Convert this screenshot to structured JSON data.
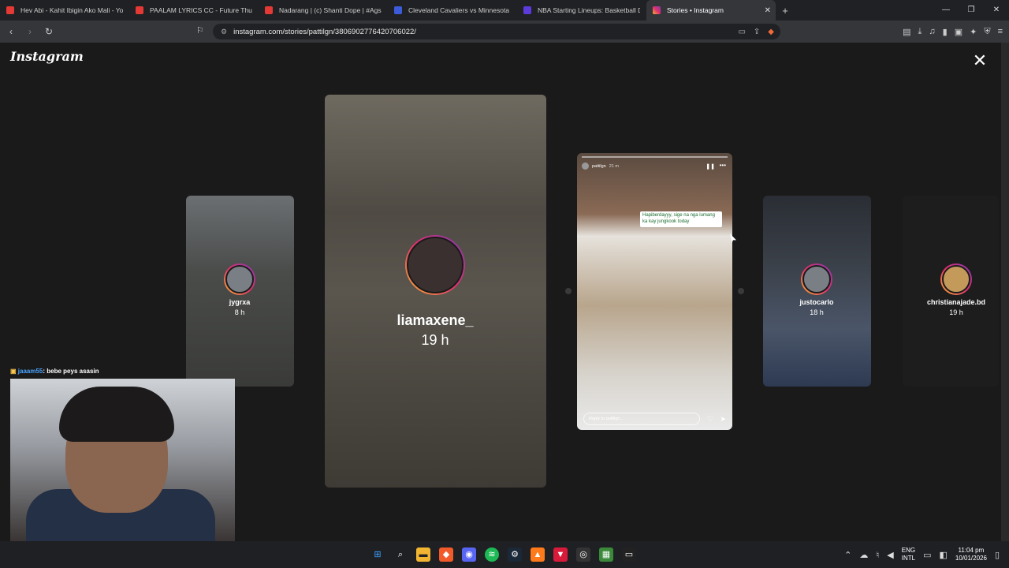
{
  "browser": {
    "tabs": [
      {
        "title": "Hev Abi - Kahit Ibigin Ako Mali - You",
        "color": "#e53935"
      },
      {
        "title": "PAALAM LYRICS CC - Future Thug ft.",
        "color": "#e53935"
      },
      {
        "title": "Nadarang | (c) Shanti Dope | #Agsun",
        "color": "#e53935"
      },
      {
        "title": "Cleveland Cavaliers vs Minnesota Tim",
        "color": "#3b5bdb"
      },
      {
        "title": "NBA Starting Lineups: Basketball Dai",
        "color": "#5c3bdb"
      },
      {
        "title": "Stories • Instagram",
        "color": "#e1306c",
        "active": true
      }
    ],
    "url": "instagram.com/stories/pattilgn/3806902776420706022/"
  },
  "instagram": {
    "logo": "Instagram",
    "close_icon": "close-icon",
    "previews": {
      "left": {
        "name": "jygrxa",
        "time": "8 h"
      },
      "center": {
        "name": "liamaxene_",
        "time": "19 h"
      },
      "right1": {
        "name": "justocarlo",
        "time": "18 h"
      },
      "right2": {
        "name": "christianajade.bd",
        "time": "19 h"
      }
    },
    "active_story": {
      "user": "pattilgn",
      "time": "21 m",
      "sticker_text": "Hapiberdayyy, sige na nga lumang ka kay jungkook today",
      "reply_placeholder": "Reply to pattilgn..."
    }
  },
  "stream": {
    "chat_user": "jaaam55",
    "chat_message": ": bebe peys asasin"
  },
  "taskbar": {
    "lang_line1": "ENG",
    "lang_line2": "INTL",
    "time": "11:04 pm",
    "date": "10/01/2026"
  }
}
